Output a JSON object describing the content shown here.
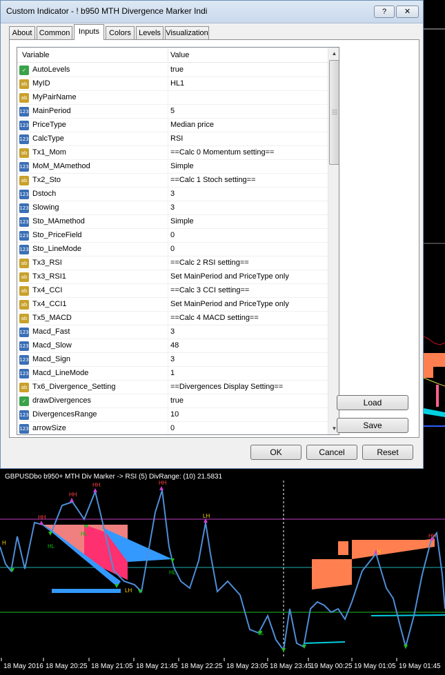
{
  "window": {
    "title": "Custom Indicator - !   b950 MTH Divergence Marker Indi",
    "help": "?",
    "close": "✕"
  },
  "tabs": [
    "About",
    "Common",
    "Inputs",
    "Colors",
    "Levels",
    "Visualization"
  ],
  "active_tab": "Inputs",
  "grid": {
    "columns": [
      "Variable",
      "Value"
    ],
    "rows": [
      {
        "type": "bool",
        "name": "AutoLevels",
        "value": "true"
      },
      {
        "type": "str",
        "name": "MyID",
        "value": "HL1"
      },
      {
        "type": "str",
        "name": "MyPairName",
        "value": ""
      },
      {
        "type": "int",
        "name": "MainPeriod",
        "value": "5"
      },
      {
        "type": "int",
        "name": "PriceType",
        "value": "Median price"
      },
      {
        "type": "int",
        "name": "CalcType",
        "value": "RSI"
      },
      {
        "type": "str",
        "name": "Tx1_Mom",
        "value": "==Calc 0 Momentum setting=="
      },
      {
        "type": "int",
        "name": "MoM_MAmethod",
        "value": "Simple"
      },
      {
        "type": "str",
        "name": "Tx2_Sto",
        "value": "==Calc 1 Stoch setting=="
      },
      {
        "type": "int",
        "name": "Dstoch",
        "value": "3"
      },
      {
        "type": "int",
        "name": "Slowing",
        "value": "3"
      },
      {
        "type": "int",
        "name": "Sto_MAmethod",
        "value": "Simple"
      },
      {
        "type": "int",
        "name": "Sto_PriceField",
        "value": "0"
      },
      {
        "type": "int",
        "name": "Sto_LineMode",
        "value": "0"
      },
      {
        "type": "str",
        "name": "Tx3_RSI",
        "value": "==Calc 2 RSI setting=="
      },
      {
        "type": "str",
        "name": "Tx3_RSI1",
        "value": "Set MainPeriod and PriceType only"
      },
      {
        "type": "str",
        "name": "Tx4_CCI",
        "value": "==Calc 3 CCI setting=="
      },
      {
        "type": "str",
        "name": "Tx4_CCI1",
        "value": "Set MainPeriod and PriceType only"
      },
      {
        "type": "str",
        "name": "Tx5_MACD",
        "value": "==Calc 4 MACD setting=="
      },
      {
        "type": "int",
        "name": "Macd_Fast",
        "value": "3"
      },
      {
        "type": "int",
        "name": "Macd_Slow",
        "value": "48"
      },
      {
        "type": "int",
        "name": "Macd_Sign",
        "value": "3"
      },
      {
        "type": "int",
        "name": "Macd_LineMode",
        "value": "1"
      },
      {
        "type": "str",
        "name": "Tx6_Divergence_Setting",
        "value": "==Divergences Display Setting=="
      },
      {
        "type": "bool",
        "name": "drawDivergences",
        "value": "true"
      },
      {
        "type": "int",
        "name": "DivergencesRange",
        "value": "10"
      },
      {
        "type": "int",
        "name": "arrowSize",
        "value": "0"
      }
    ]
  },
  "icons": {
    "bool": "toggle-icon",
    "str": "ab",
    "int": "123"
  },
  "buttons": {
    "load": "Load",
    "save": "Save",
    "ok": "OK",
    "cancel": "Cancel",
    "reset": "Reset"
  },
  "chart": {
    "title": "GBPUSDbo b950+ MTH Div Marker -> RSI (5) DivRange: (10) 21.5831",
    "time_labels": [
      "18 May 2016",
      "18 May 20:25",
      "18 May 21:05",
      "18 May 21:45",
      "18 May 22:25",
      "18 May 23:05",
      "18 May 23:45",
      "19 May 00:25",
      "19 May 01:05",
      "19 May 01:45"
    ],
    "markers": [
      {
        "text": "HH",
        "color": "#ff4040"
      },
      {
        "text": "HH",
        "color": "#ff4040"
      },
      {
        "text": "HH",
        "color": "#ff4040"
      },
      {
        "text": "HH",
        "color": "#ff4040"
      },
      {
        "text": "LH",
        "color": "#ffd000"
      },
      {
        "text": "HL",
        "color": "#00c000"
      },
      {
        "text": "HL",
        "color": "#00c000"
      },
      {
        "text": "HL",
        "color": "#00c000"
      },
      {
        "text": "LH",
        "color": "#ffd000"
      },
      {
        "text": "LL",
        "color": "#00c000"
      },
      {
        "text": "H",
        "color": "#ffd000"
      },
      {
        "text": "H",
        "color": "#ffd000"
      },
      {
        "text": "HH",
        "color": "#ff4040"
      }
    ]
  }
}
